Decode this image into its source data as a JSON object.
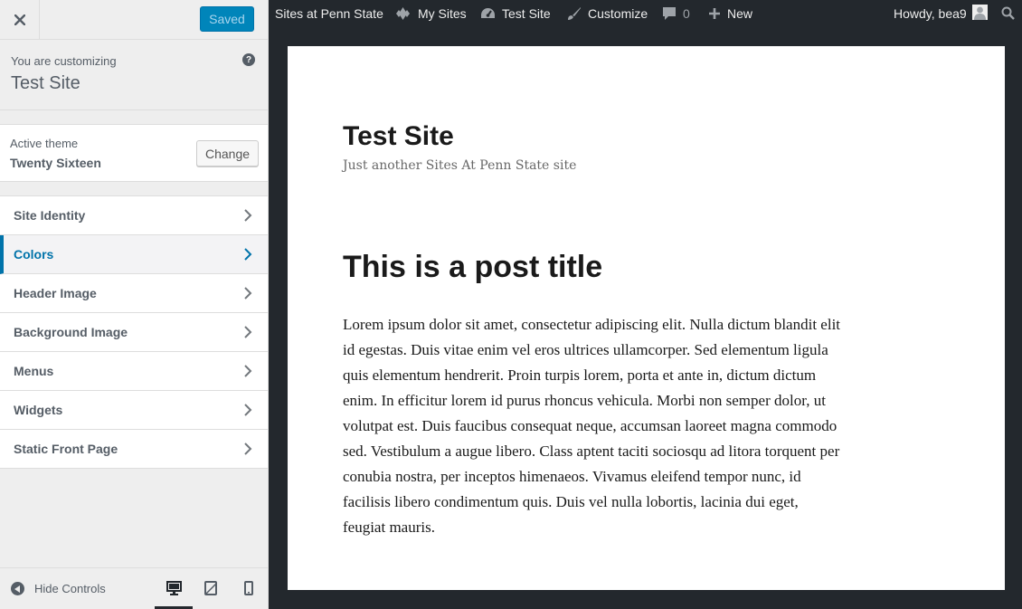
{
  "sidebar": {
    "header": {
      "close_icon": "close-icon",
      "save_status": "Saved"
    },
    "customizing": {
      "label": "You are customizing",
      "title": "Test Site",
      "help_icon": "?"
    },
    "theme": {
      "label": "Active theme",
      "name": "Twenty Sixteen",
      "change_label": "Change"
    },
    "sections": [
      {
        "label": "Site Identity",
        "active": false
      },
      {
        "label": "Colors",
        "active": true
      },
      {
        "label": "Header Image",
        "active": false
      },
      {
        "label": "Background Image",
        "active": false
      },
      {
        "label": "Menus",
        "active": false
      },
      {
        "label": "Widgets",
        "active": false
      },
      {
        "label": "Static Front Page",
        "active": false
      }
    ],
    "footer": {
      "hide_label": "Hide Controls",
      "devices": [
        "desktop-icon",
        "tablet-icon",
        "mobile-icon"
      ],
      "active_device": "desktop"
    }
  },
  "adminbar": {
    "network": "Sites at Penn State",
    "my_sites": "My Sites",
    "site": "Test Site",
    "customize": "Customize",
    "comments_count": "0",
    "new_label": "New",
    "howdy": "Howdy, bea9"
  },
  "preview": {
    "site_title": "Test Site",
    "site_description": "Just another Sites At Penn State site",
    "post_title": "This is a post title",
    "post_body": "Lorem ipsum dolor sit amet, consectetur adipiscing elit. Nulla dictum blandit elit id egestas. Duis vitae enim vel eros ultrices ullamcorper. Sed elementum ligula quis elementum hendrerit. Proin turpis lorem, porta et ante in, dictum dictum enim. In efficitur lorem id purus rhoncus vehicula. Morbi non semper dolor, ut volutpat est. Duis faucibus consequat neque, accumsan laoreet magna commodo sed. Vestibulum a augue libero. Class aptent taciti sociosqu ad litora torquent per conubia nostra, per inceptos himenaeos. Vivamus eleifend tempor nunc, id facilisis libero condimentum quis. Duis vel nulla lobortis, lacinia dui eget, feugiat mauris."
  },
  "colors": {
    "accent": "#0073aa",
    "primary_button": "#0085ba",
    "adminbar_bg": "#23282d",
    "sidebar_bg": "#eeeeee"
  }
}
